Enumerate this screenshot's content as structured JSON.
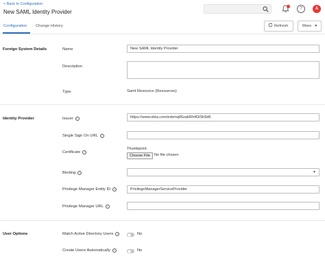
{
  "header": {
    "back_link": "< Back to Configuration",
    "title": "New SAML Identity Provider",
    "search_value": "",
    "avatar_initial": "A",
    "help_glyph": "?"
  },
  "tabs": [
    {
      "label": "Configuration",
      "active": true
    },
    {
      "label": "Change History",
      "active": false
    }
  ],
  "toolbar": {
    "refresh_label": "Refresh",
    "more_label": "More"
  },
  "sections": {
    "foreign_system": "Foreign System Details",
    "identity_provider": "Identity Provider",
    "user_options": "User Options"
  },
  "fields": {
    "name_label": "Name",
    "name_value": "New SAML Identity Provider",
    "description_label": "Description",
    "description_value": "",
    "type_label": "Type",
    "type_value": "Saml Resource (Resources)",
    "issuer_label": "Issuer",
    "issuer_value": "https://www.okta.com/exkmq06zakRh4DiSh5d6",
    "sso_url_label": "Single Sign On URL",
    "sso_url_value": "",
    "certificate_label": "Certificate",
    "thumbprint_label": "Thumbprint:",
    "choose_file_label": "Choose File",
    "file_status": "No file chosen",
    "binding_label": "Binding",
    "binding_value": "",
    "pm_entity_label": "Privilege Manager Entity ID",
    "pm_entity_value": "PrivilegeManagerServiceProvider",
    "pm_url_label": "Privilege Manager URL",
    "pm_url_value": "",
    "match_ad_label": "Match Active Directory Users",
    "match_ad_value": "No",
    "create_users_label": "Create Users Automatically",
    "create_users_value": "No"
  },
  "colors": {
    "accent": "#2a6ebb",
    "avatar": "#e53935",
    "notification_dot": "#e53935"
  },
  "icons": [
    "search-icon",
    "bell-icon",
    "help-icon",
    "refresh-icon",
    "chevron-down-icon",
    "info-icon"
  ]
}
